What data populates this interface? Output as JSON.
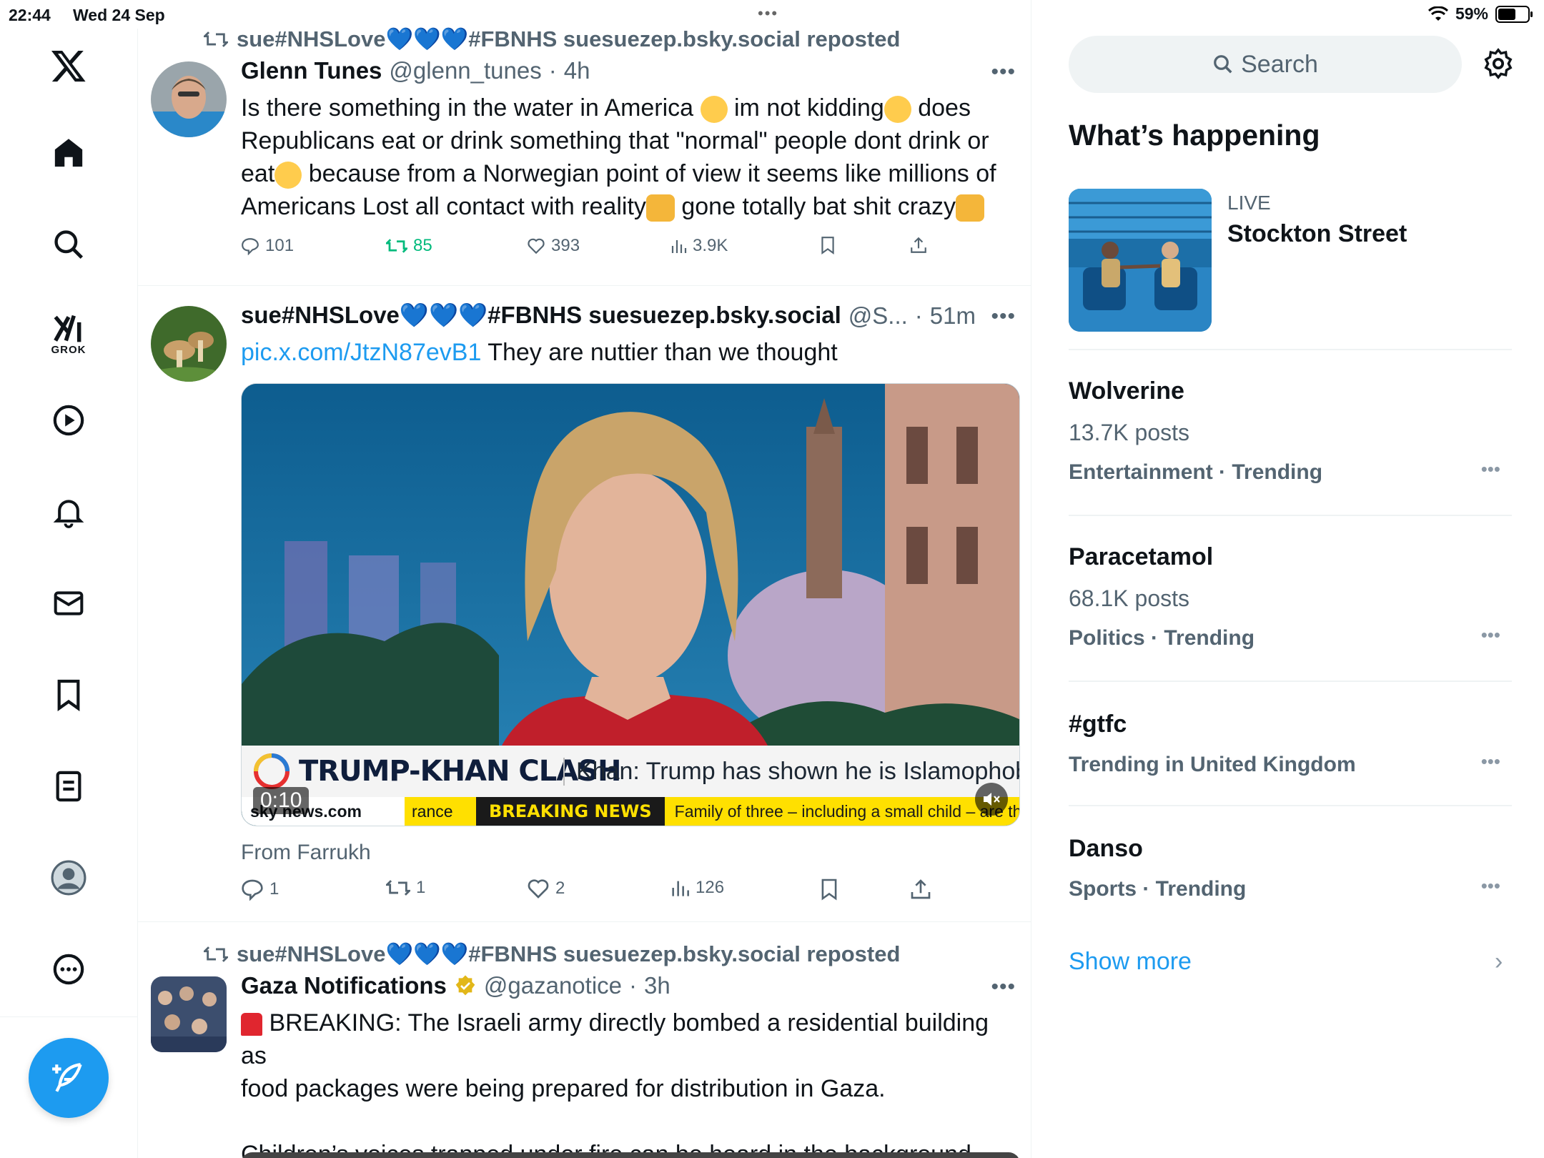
{
  "status": {
    "time": "22:44",
    "date": "Wed 24 Sep",
    "battery": "59%",
    "battery_level": 0.59
  },
  "nav": {
    "items": [
      "home-icon",
      "search-icon",
      "grok-icon",
      "video-icon",
      "notifications-icon",
      "messages-icon",
      "bookmarks-icon",
      "lists-icon",
      "profile-icon",
      "more-icon"
    ],
    "grok_label": "GROK"
  },
  "feed": {
    "tweets": [
      {
        "repost_by": "sue#NHSLove💙💙💙#FBNHS suesuezep.bsky.social reposted",
        "name": "Glenn Tunes",
        "handle": "@glenn_tunes",
        "time": "4h",
        "text_lines": [
          "Is there something in the water in America",
          "im not kidding",
          "does",
          "Republicans eat or drink something that \"normal\" people dont drink or",
          "eat",
          "because from a Norwegian point of view it seems like millions of",
          "Americans Lost all contact with reality",
          "gone totally bat shit crazy"
        ],
        "replies": "101",
        "reposts": "85",
        "likes": "393",
        "views": "3.9K"
      },
      {
        "name": "sue#NHSLove💙💙💙#FBNHS suesuezep.bsky.social",
        "handle": "@S...",
        "time": "51m",
        "link": "pic.x.com/JtzN87evB1",
        "text": "They are nuttier than we thought",
        "media": {
          "headline": "TRUMP-KHAN CLASH",
          "subline": "Khan: Trump has shown he is Islamophob",
          "channel": "sky news.com",
          "ticker_prefix": "rance",
          "breaking": "BREAKING NEWS",
          "ticker": "Family of three – including a small child – are the f",
          "duration": "0:10"
        },
        "from": "From Farrukh",
        "replies": "1",
        "reposts": "1",
        "likes": "2",
        "views": "126"
      },
      {
        "repost_by": "sue#NHSLove💙💙💙#FBNHS suesuezep.bsky.social reposted",
        "name": "Gaza Notifications",
        "handle": "@gazanotice",
        "time": "3h",
        "text_line1": "BREAKING: The Israeli army directly bombed a residential building as",
        "text_line2": "food packages were being prepared for distribution in Gaza.",
        "text_line3": "Children’s voices trapped under fire can be heard in the background."
      }
    ]
  },
  "sidebar": {
    "search_placeholder": "Search",
    "title": "What’s happening",
    "live": {
      "label": "LIVE",
      "name": "Stockton Street"
    },
    "trends": [
      {
        "name": "Wolverine",
        "count": "13.7K posts",
        "category": "Entertainment · Trending"
      },
      {
        "name": "Paracetamol",
        "count": "68.1K posts",
        "category": "Politics · Trending"
      },
      {
        "name": "#gtfc",
        "count": "",
        "category": "Trending in United Kingdom"
      },
      {
        "name": "Danso",
        "count": "",
        "category": "Sports · Trending"
      }
    ],
    "show_more": "Show more"
  },
  "colors": {
    "accent": "#1d9bf0",
    "secondary_text": "#536471",
    "repost_green": "#00ba7c"
  }
}
